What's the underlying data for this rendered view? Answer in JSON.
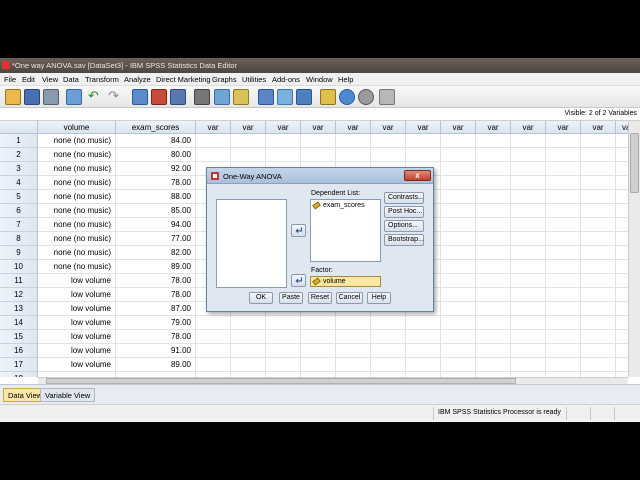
{
  "window": {
    "title": "*One way ANOVA.sav [DataSet3] - IBM SPSS Statistics Data Editor"
  },
  "menu": [
    "File",
    "Edit",
    "View",
    "Data",
    "Transform",
    "Analyze",
    "Direct Marketing",
    "Graphs",
    "Utilities",
    "Add-ons",
    "Window",
    "Help"
  ],
  "cellbar": {
    "visible": "Visible: 2 of 2 Variables"
  },
  "grid": {
    "columns": [
      "volume",
      "exam_scores",
      "var",
      "var",
      "var",
      "var",
      "var",
      "var",
      "var",
      "var",
      "var",
      "var",
      "var",
      "var",
      "var"
    ],
    "rows": [
      {
        "num": "1",
        "volume": "none (no music)",
        "score": "84.00"
      },
      {
        "num": "2",
        "volume": "none (no music)",
        "score": "80.00"
      },
      {
        "num": "3",
        "volume": "none (no music)",
        "score": "92.00"
      },
      {
        "num": "4",
        "volume": "none (no music)",
        "score": "78.00"
      },
      {
        "num": "5",
        "volume": "none (no music)",
        "score": "88.00"
      },
      {
        "num": "6",
        "volume": "none (no music)",
        "score": "85.00"
      },
      {
        "num": "7",
        "volume": "none (no music)",
        "score": "94.00"
      },
      {
        "num": "8",
        "volume": "none (no music)",
        "score": "77.00"
      },
      {
        "num": "9",
        "volume": "none (no music)",
        "score": "82.00"
      },
      {
        "num": "10",
        "volume": "none (no music)",
        "score": "89.00"
      },
      {
        "num": "11",
        "volume": "low volume",
        "score": "78.00"
      },
      {
        "num": "12",
        "volume": "low volume",
        "score": "78.00"
      },
      {
        "num": "13",
        "volume": "low volume",
        "score": "87.00"
      },
      {
        "num": "14",
        "volume": "low volume",
        "score": "79.00"
      },
      {
        "num": "15",
        "volume": "low volume",
        "score": "78.00"
      },
      {
        "num": "16",
        "volume": "low volume",
        "score": "91.00"
      },
      {
        "num": "17",
        "volume": "low volume",
        "score": "89.00"
      },
      {
        "num": "18",
        "volume": "",
        "score": ""
      }
    ]
  },
  "tabs": {
    "data_view": "Data View",
    "variable_view": "Variable View"
  },
  "status": {
    "processor": "IBM SPSS Statistics Processor is ready"
  },
  "dialog": {
    "title": "One-Way ANOVA",
    "close": "x",
    "dependent_label": "Dependent List:",
    "dependent_item": "exam_scores",
    "factor_label": "Factor:",
    "factor_value": "volume",
    "contrasts": "Contrasts...",
    "posthoc": "Post Hoc...",
    "options": "Options...",
    "bootstrap": "Bootstrap...",
    "ok": "OK",
    "paste": "Paste",
    "reset": "Reset",
    "cancel": "Cancel",
    "help": "Help"
  }
}
